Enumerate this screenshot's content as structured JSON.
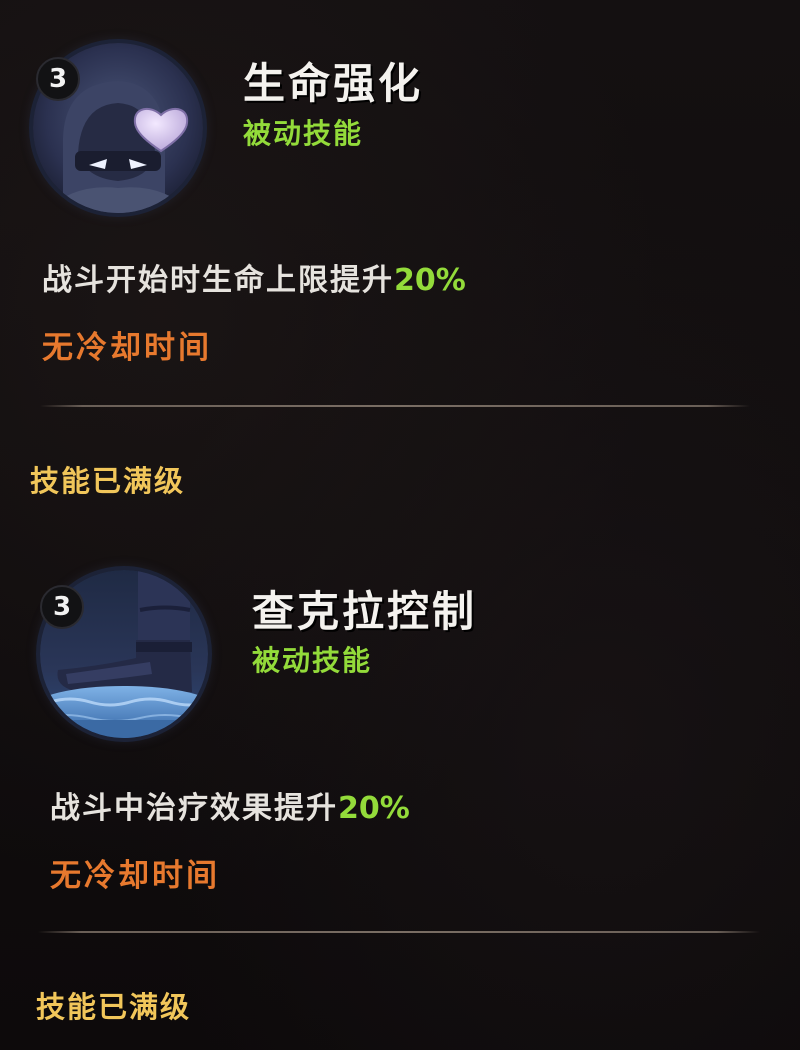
{
  "skills": [
    {
      "level": "3",
      "icon": "ninja-heart-icon",
      "name": "生命强化",
      "type": "被动技能",
      "description": "战斗开始时生命上限提升",
      "description_value": "20%",
      "cooldown": "无冷却时间",
      "status": "技能已满级"
    },
    {
      "level": "3",
      "icon": "boot-icon",
      "name": "查克拉控制",
      "type": "被动技能",
      "description": "战斗中治疗效果提升",
      "description_value": "20%",
      "cooldown": "无冷却时间",
      "status": "技能已满级"
    }
  ],
  "colors": {
    "background": "#0f0c0d",
    "skill_type": "#93db3a",
    "percent_value": "#93db3a",
    "cooldown": "#e7792e",
    "max_level": "#f1c65a"
  }
}
